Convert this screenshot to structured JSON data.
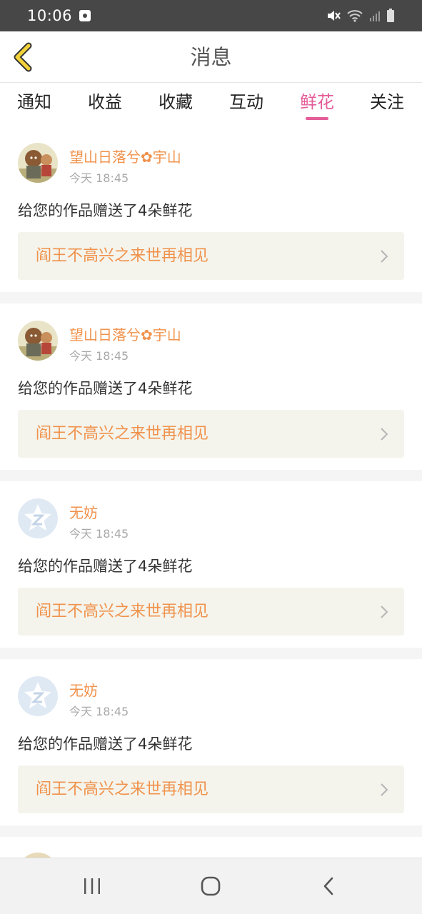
{
  "status_bar": {
    "time": "10:06"
  },
  "header": {
    "title": "消息"
  },
  "tabs": [
    {
      "label": "通知"
    },
    {
      "label": "收益"
    },
    {
      "label": "收藏"
    },
    {
      "label": "互动"
    },
    {
      "label": "鲜花",
      "active": true
    },
    {
      "label": "关注"
    }
  ],
  "feed": [
    {
      "username": "望山日落兮✿宇山",
      "time": "今天 18:45",
      "message": "给您的作品赠送了4朵鲜花",
      "work": "阎王不高兴之来世再相见",
      "avatar": "character-avatar"
    },
    {
      "username": "望山日落兮✿宇山",
      "time": "今天 18:45",
      "message": "给您的作品赠送了4朵鲜花",
      "work": "阎王不高兴之来世再相见",
      "avatar": "character-avatar"
    },
    {
      "username": "无妨",
      "time": "今天 18:45",
      "message": "给您的作品赠送了4朵鲜花",
      "work": "阎王不高兴之来世再相见",
      "avatar": "default-star-avatar"
    },
    {
      "username": "无妨",
      "time": "今天 18:45",
      "message": "给您的作品赠送了4朵鲜花",
      "work": "阎王不高兴之来世再相见",
      "avatar": "default-star-avatar"
    }
  ],
  "colors": {
    "accent_pink": "#e45c98",
    "username_orange": "#f0924c",
    "link_background": "#f4f4ec",
    "back_arrow": "#f2d23a"
  },
  "icons": [
    "back-arrow-icon",
    "chevron-right-icon",
    "recents-icon",
    "home-icon",
    "back-nav-icon"
  ]
}
